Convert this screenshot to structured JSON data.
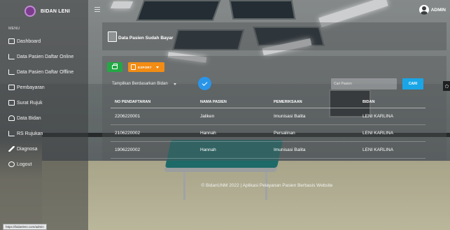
{
  "brand": {
    "name": "BIDAN LENI"
  },
  "header": {
    "user_label": "ADMIN"
  },
  "sidebar": {
    "heading": "MENU",
    "items": [
      {
        "label": "Dashboard",
        "icon": "dashboard-icon"
      },
      {
        "label": "Data Pasien Daftar Online",
        "icon": "chart-icon"
      },
      {
        "label": "Data Pasien Daftar Offline",
        "icon": "chart-icon"
      },
      {
        "label": "Pembayaran",
        "icon": "payment-icon"
      },
      {
        "label": "Surat Rujuk",
        "icon": "document-icon"
      },
      {
        "label": "Data Bidan",
        "icon": "user-icon"
      },
      {
        "label": "RS Rujukan",
        "icon": "hospital-icon"
      },
      {
        "label": "Diagnosa",
        "icon": "pen-icon"
      },
      {
        "label": "Logout",
        "icon": "logout-icon"
      }
    ]
  },
  "page": {
    "title": "Data Pasien Sudah Bayar"
  },
  "toolbar": {
    "export_label": "EXPORT",
    "filter_label": "Tampilkan Berdasarkan Bidan",
    "search_placeholder": "Cari Pasien",
    "search_button": "CARI"
  },
  "table": {
    "headers": [
      "NO PENDAFTARAN",
      "NAMA PASIEN",
      "PEMERIKSAAN",
      "BIDAN"
    ],
    "rows": [
      [
        "2206220001",
        "Jaliken",
        "Imunisasi Balita",
        "LENI KARLINA"
      ],
      [
        "2106220002",
        "Hannah",
        "Persalinan",
        "LENI KARLINA"
      ],
      [
        "1906220002",
        "Hannah",
        "Imunisasi Balita",
        "LENI KARLINA"
      ]
    ]
  },
  "footer": {
    "text": "© BidanUNM 2022 | Aplikasi Pelayanan Pasien Berbasis Website"
  },
  "status_bar": {
    "url": "https://bidanleni.com/admin"
  },
  "colors": {
    "print_button": "#23a845",
    "export_button": "#f28c14",
    "apply_button": "#2a95e8",
    "search_button": "#1aa6e6",
    "logo": "#7b3c8e"
  }
}
